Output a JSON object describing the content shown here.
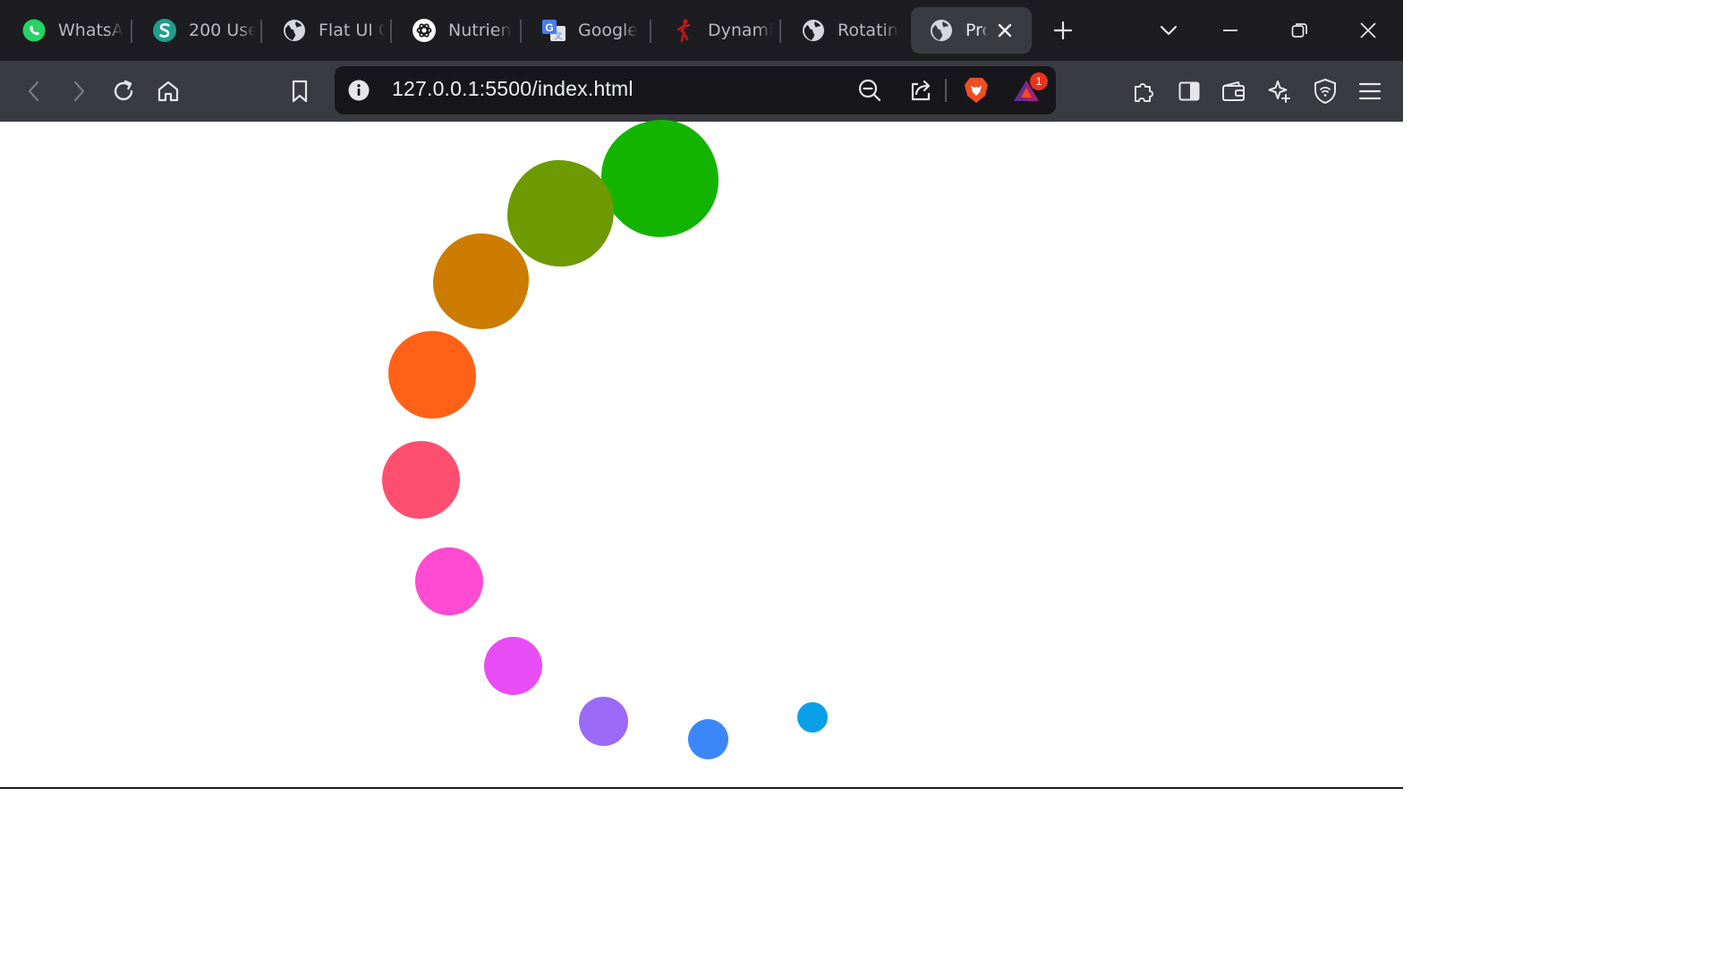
{
  "tabs": [
    {
      "title": "WhatsA",
      "icon": "whatsapp-icon"
    },
    {
      "title": "200 Use",
      "icon": "s-logo-icon"
    },
    {
      "title": "Flat UI C",
      "icon": "globe-icon"
    },
    {
      "title": "Nutrien",
      "icon": "openai-icon"
    },
    {
      "title": "Google",
      "icon": "google-translate-icon"
    },
    {
      "title": "Dynami",
      "icon": "figure-icon"
    },
    {
      "title": "Rotatin",
      "icon": "globe-icon"
    },
    {
      "title": "Pro",
      "icon": "globe-icon",
      "active": true
    }
  ],
  "address_bar": {
    "url": "127.0.0.1:5500/index.html",
    "rewards_badge": "1"
  },
  "colors": {
    "tab_strip": "#1c1c21",
    "toolbar": "#3a3a42",
    "url_field": "#17171b",
    "brave_orange": "#f04e23",
    "badge_red": "#e8331c"
  },
  "spinner": {
    "dot_colors": [
      "#13b400",
      "#6c9a00",
      "#cc7c00",
      "#ff6217",
      "#ff4f70",
      "#ff4bd1",
      "#e84df5",
      "#9b6af6",
      "#3b87fa",
      "#0aa0e8"
    ]
  }
}
